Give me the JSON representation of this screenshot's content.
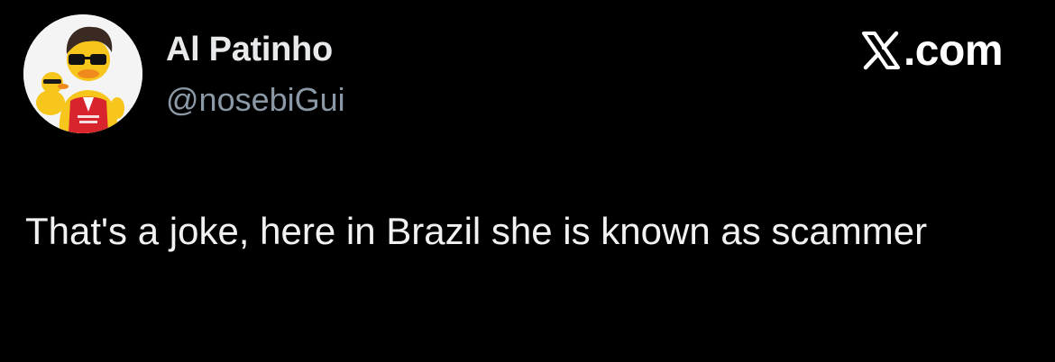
{
  "brand": {
    "icon": "x-logo-icon",
    "text": ".com"
  },
  "author": {
    "display_name": "Al Patinho",
    "handle": "@nosebiGui",
    "avatar_icon": "rubber-duck-avatar"
  },
  "tweet": {
    "text": "That's a joke, here in Brazil she is known as scammer"
  },
  "colors": {
    "background": "#000000",
    "primary_text": "#e7e9ea",
    "secondary_text": "#8b98a5",
    "avatar_bg": "#f4f4f4",
    "duck_yellow": "#f6c61d",
    "shirt_red": "#d8242d"
  }
}
